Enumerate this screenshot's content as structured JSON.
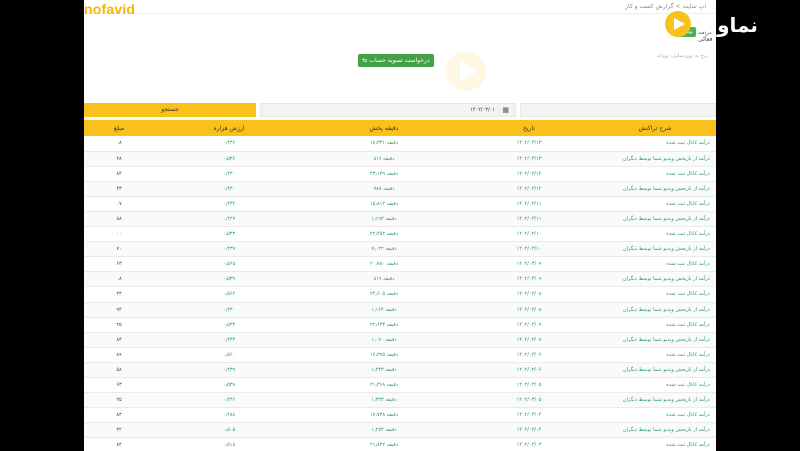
{
  "brand": {
    "watermark_text": "nofavid",
    "logo_text": "نماوید"
  },
  "topbar": {
    "path_text": "اپ سایت > گزارش کسب و کار"
  },
  "stats": {
    "badge": "۰ تومان",
    "label": "درآمد فعالی"
  },
  "note": "نرخ به روزرسانی: روزانه",
  "actions": {
    "settle_label": "درخواست تسویه حساب",
    "search_label": "جستجو"
  },
  "filters": {
    "date_value": "۱۴۰۲/۰۳/۰۱"
  },
  "table": {
    "headers": [
      "مبلغ",
      "ارزش هزاره",
      "دقیقه پخش",
      "تاریخ",
      "شرح تراکنش"
    ],
    "rows": [
      {
        "amount": "۰۸",
        "pct": "۰٫۴۳۶",
        "minutes": "۱۸٫۳۳۱ دقیقه",
        "date": "۱۴۰۲/۰۳/۱۳",
        "desc": "درآمد کانال ثبت شده"
      },
      {
        "amount": "۲۸",
        "pct": "۰٫۵۳۶",
        "minutes": "۸۱۶ دقیقه",
        "date": "۱۴۰۲/۰۳/۱۳",
        "desc": "درآمد از بازپخش ویدیو شما توسط دیگران"
      },
      {
        "amount": "۸۴",
        "pct": "۰٫۴۳۰",
        "minutes": "۲۳٫۱۳۹ دقیقه",
        "date": "۱۴۰۲/۰۳/۱۲",
        "desc": "درآمد کانال ثبت شده"
      },
      {
        "amount": "۴۳",
        "pct": "۰٫۴۳۰",
        "minutes": "۷۸۸ دقیقه",
        "date": "۱۴۰۲/۰۳/۱۲",
        "desc": "درآمد از بازپخش ویدیو شما توسط دیگران"
      },
      {
        "amount": "۰۷",
        "pct": "۰٫۴۳۲",
        "minutes": "۱۵٫۸۱۲ دقیقه",
        "date": "۱۴۰۲/۰۳/۱۱",
        "desc": "درآمد کانال ثبت شده"
      },
      {
        "amount": "۸۸",
        "pct": "۰٫۴۲۷",
        "minutes": "۱٫۱۹۳ دقیقه",
        "date": "۱۴۰۲/۰۳/۱۱",
        "desc": "درآمد از بازپخش ویدیو شما توسط دیگران"
      },
      {
        "amount": "۰۰",
        "pct": "۰٫۵۳۳",
        "minutes": "۲۲٫۴۵۲ دقیقه",
        "date": "۱۴۰۲/۰۳/۱۰",
        "desc": "درآمد کانال ثبت شده"
      },
      {
        "amount": "۷۰",
        "pct": "۰٫۴۳۷",
        "minutes": "۷٫۰۴۲ دقیقه",
        "date": "۱۴۰۲/۰۳/۱۰",
        "desc": "درآمد از بازپخش ویدیو شما توسط دیگران"
      },
      {
        "amount": "۶۳",
        "pct": "۰٫۵۶۵",
        "minutes": "۲۰٫۷۸۰ دقیقه",
        "date": "۱۴۰۲/۰۳/۰۹",
        "desc": "درآمد کانال ثبت شده"
      },
      {
        "amount": "۰۸",
        "pct": "۰٫۵۳۹",
        "minutes": "۸۱۹ دقیقه",
        "date": "۱۴۰۲/۰۳/۰۹",
        "desc": "درآمد از بازپخش ویدیو شما توسط دیگران"
      },
      {
        "amount": "۲۳",
        "pct": "۰٫۵۶۲",
        "minutes": "۲۴٫۶۰۵ دقیقه",
        "date": "۱۴۰۲/۰۳/۰۸",
        "desc": "درآمد کانال ثبت شده"
      },
      {
        "amount": "۹۴",
        "pct": "۰٫۴۳۰",
        "minutes": "۱٫۱۶۴ دقیقه",
        "date": "۱۴۰۲/۰۳/۰۸",
        "desc": "درآمد از بازپخش ویدیو شما توسط دیگران"
      },
      {
        "amount": "۲۵",
        "pct": "۰٫۵۳۳",
        "minutes": "۲۲٫۶۳۳ دقیقه",
        "date": "۱۴۰۲/۰۳/۰۷",
        "desc": "درآمد کانال ثبت شده"
      },
      {
        "amount": "۸۳",
        "pct": "۰٫۴۳۳",
        "minutes": "۱٫۰۷۰ دقیقه",
        "date": "۱۴۰۲/۰۳/۰۷",
        "desc": "درآمد از بازپخش ویدیو شما توسط دیگران"
      },
      {
        "amount": "۸۹",
        "pct": "۰٫۵۶۰",
        "minutes": "۱۶٫۳۷۵ دقیقه",
        "date": "۱۴۰۲/۰۳/۰۶",
        "desc": "درآمد کانال ثبت شده"
      },
      {
        "amount": "۵۸",
        "pct": "۰٫۴۳۹",
        "minutes": "۱٫۴۴۳ دقیقه",
        "date": "۱۴۰۲/۰۳/۰۶",
        "desc": "درآمد از بازپخش ویدیو شما توسط دیگران"
      },
      {
        "amount": "۶۳",
        "pct": "۰٫۵۳۸",
        "minutes": "۲۱٫۳۶۸ دقیقه",
        "date": "۱۴۰۲/۰۳/۰۵",
        "desc": "درآمد کانال ثبت شده"
      },
      {
        "amount": "۲۵",
        "pct": "۰٫۴۳۶",
        "minutes": "۱٫۳۲۳ دقیقه",
        "date": "۱۴۰۲/۰۳/۰۵",
        "desc": "درآمد از بازپخش ویدیو شما توسط دیگران"
      },
      {
        "amount": "۸۳",
        "pct": "۰٫۴۸۸",
        "minutes": "۱۷٫۷۳۸ دقیقه",
        "date": "۱۴۰۲/۰۳/۰۴",
        "desc": "درآمد کانال ثبت شده"
      },
      {
        "amount": "۲۲",
        "pct": "۰٫۵۰۵",
        "minutes": "۱٫۲۷۴ دقیقه",
        "date": "۱۴۰۲/۰۳/۰۴",
        "desc": "درآمد از بازپخش ویدیو شما توسط دیگران"
      },
      {
        "amount": "۸۴",
        "pct": "۰٫۵۱۸",
        "minutes": "۲۱٫۸۴۲ دقیقه",
        "date": "۱۴۰۲/۰۳/۰۳",
        "desc": "درآمد کانال ثبت شده"
      }
    ]
  },
  "colors": {
    "accent": "#f9c11a",
    "green": "#43a047",
    "text_green": "#2e9a5e"
  }
}
